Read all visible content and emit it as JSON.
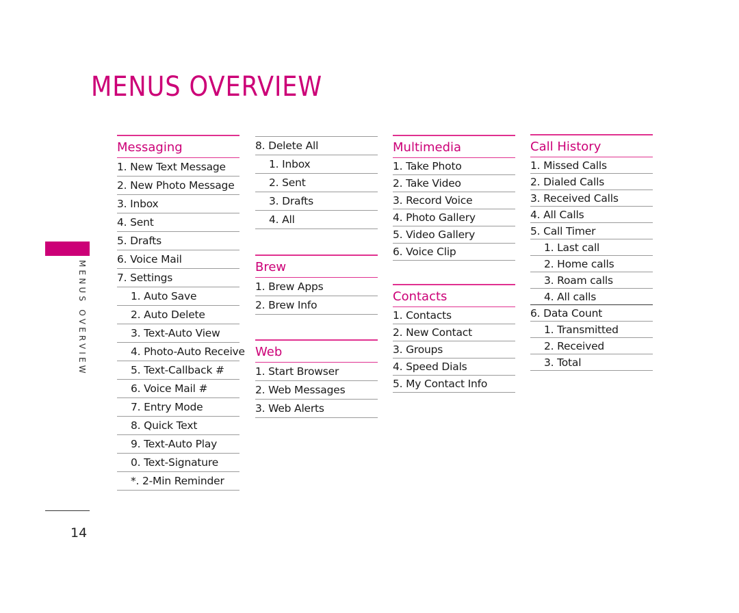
{
  "page": {
    "title": "MENUS OVERVIEW",
    "side_label": "MENUS OVERVIEW",
    "page_number": "14",
    "accent_color": "#cc0077"
  },
  "columns": [
    {
      "sections": [
        {
          "heading": "Messaging",
          "items": [
            {
              "label": "1. New Text Message",
              "level": 0
            },
            {
              "label": "2. New Photo Message",
              "level": 0
            },
            {
              "label": "3. Inbox",
              "level": 0
            },
            {
              "label": "4. Sent",
              "level": 0
            },
            {
              "label": "5. Drafts",
              "level": 0
            },
            {
              "label": "6. Voice Mail",
              "level": 0
            },
            {
              "label": "7. Settings",
              "level": 0
            },
            {
              "label": "1. Auto Save",
              "level": 1
            },
            {
              "label": "2. Auto Delete",
              "level": 1
            },
            {
              "label": "3. Text-Auto View",
              "level": 1
            },
            {
              "label": "4. Photo-Auto Receive",
              "level": 1
            },
            {
              "label": "5. Text-Callback #",
              "level": 1
            },
            {
              "label": "6. Voice Mail #",
              "level": 1
            },
            {
              "label": "7. Entry Mode",
              "level": 1
            },
            {
              "label": "8. Quick Text",
              "level": 1
            },
            {
              "label": "9. Text-Auto Play",
              "level": 1
            },
            {
              "label": "0. Text-Signature",
              "level": 1
            },
            {
              "label": "*. 2-Min Reminder",
              "level": 1
            }
          ]
        }
      ]
    },
    {
      "sections": [
        {
          "heading": "",
          "items": [
            {
              "label": "8. Delete All",
              "level": 0
            },
            {
              "label": "1. Inbox",
              "level": 1
            },
            {
              "label": "2. Sent",
              "level": 1
            },
            {
              "label": "3. Drafts",
              "level": 1
            },
            {
              "label": "4. All",
              "level": 1
            }
          ]
        },
        {
          "heading": "Brew",
          "items": [
            {
              "label": "1. Brew Apps",
              "level": 0
            },
            {
              "label": "2. Brew Info",
              "level": 0
            }
          ]
        },
        {
          "heading": "Web",
          "items": [
            {
              "label": "1. Start Browser",
              "level": 0
            },
            {
              "label": "2. Web Messages",
              "level": 0
            },
            {
              "label": "3. Web Alerts",
              "level": 0
            }
          ]
        }
      ]
    },
    {
      "sections": [
        {
          "heading": "Multimedia",
          "items": [
            {
              "label": "1. Take Photo",
              "level": 0
            },
            {
              "label": "2. Take Video",
              "level": 0
            },
            {
              "label": "3. Record Voice",
              "level": 0
            },
            {
              "label": "4. Photo Gallery",
              "level": 0
            },
            {
              "label": "5. Video Gallery",
              "level": 0
            },
            {
              "label": "6. Voice Clip",
              "level": 0
            }
          ]
        },
        {
          "heading": "Contacts",
          "items": [
            {
              "label": "1. Contacts",
              "level": 0
            },
            {
              "label": "2. New Contact",
              "level": 0
            },
            {
              "label": "3. Groups",
              "level": 0
            },
            {
              "label": "4. Speed Dials",
              "level": 0
            },
            {
              "label": "5. My Contact Info",
              "level": 0
            }
          ]
        }
      ]
    },
    {
      "sections": [
        {
          "heading": "Call History",
          "items": [
            {
              "label": "1. Missed Calls",
              "level": 0
            },
            {
              "label": "2. Dialed Calls",
              "level": 0
            },
            {
              "label": "3. Received Calls",
              "level": 0
            },
            {
              "label": "4. All Calls",
              "level": 0
            },
            {
              "label": "5. Call Timer",
              "level": 0
            },
            {
              "label": "1. Last call",
              "level": 1
            },
            {
              "label": "2. Home calls",
              "level": 1
            },
            {
              "label": "3. Roam calls",
              "level": 1
            },
            {
              "label": "4. All calls",
              "level": 1
            },
            {
              "label": "6. Data Count",
              "level": 0
            },
            {
              "label": "1. Transmitted",
              "level": 1
            },
            {
              "label": "2. Received",
              "level": 1
            },
            {
              "label": "3. Total",
              "level": 1
            }
          ]
        }
      ]
    }
  ]
}
